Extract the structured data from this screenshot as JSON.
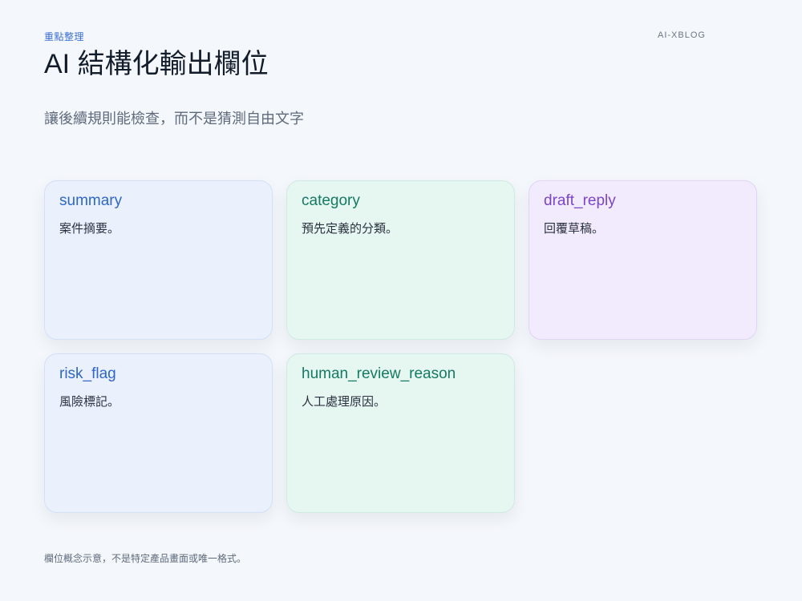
{
  "header": {
    "eyebrow": "重點整理",
    "brand": "AI-XBLOG",
    "title": "AI 結構化輸出欄位",
    "subtitle": "讓後續規則能檢查，而不是猜測自由文字"
  },
  "cards": [
    {
      "name": "summary",
      "description": "案件摘要。",
      "color": "#2f66c8"
    },
    {
      "name": "category",
      "description": "預先定義的分類。",
      "color": "#147a62"
    },
    {
      "name": "draft_reply",
      "description": "回覆草稿。",
      "color": "#7a45c8"
    },
    {
      "name": "risk_flag",
      "description": "風險標記。",
      "color": "#2f66c8"
    },
    {
      "name": "human_review_reason",
      "description": "人工處理原因。",
      "color": "#147a62"
    }
  ],
  "footnote": "欄位概念示意，不是特定產品畫面或唯一格式。"
}
